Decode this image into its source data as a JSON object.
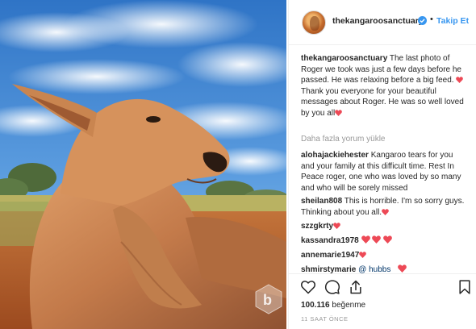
{
  "header": {
    "username": "thekangaroosanctuary",
    "dot": "•",
    "follow_label": "Takip Et"
  },
  "caption": {
    "username": "thekangaroosanctuary",
    "text_1": "The last photo of Roger we took was just a few days before he passed. He was relaxing before a big feed.",
    "text_2": "Thank you everyone for your beautiful messages about Roger. He was so well loved by you all"
  },
  "load_more": "Daha fazla yorum yükle",
  "comments": [
    {
      "username": "alohajackiehester",
      "text": "Kangaroo tears for you and your family at this difficult time. Rest In Peace roger, one who was loved by so many and who will be sorely missed"
    },
    {
      "username": "sheilan808",
      "text": "This is horrible. I'm so sorry guys. Thinking about you all."
    },
    {
      "username": "szzgkrty",
      "text": ""
    },
    {
      "username": "kassandra1978",
      "text": ""
    },
    {
      "username": "annemarie1947",
      "text": ""
    },
    {
      "username": "shmirstymarie",
      "text": "@ hubbs"
    }
  ],
  "actions": {
    "likes_count": "100.116",
    "likes_label": "beğenme",
    "time": "11 SAAT ÖNCE"
  },
  "colors": {
    "link_blue": "#3897f0",
    "heart_red": "#ed4956",
    "muted": "#999999"
  },
  "icons": [
    "verified-badge-icon",
    "heart-icon",
    "comment-icon",
    "share-icon",
    "bookmark-icon",
    "red-heart-emoji"
  ]
}
